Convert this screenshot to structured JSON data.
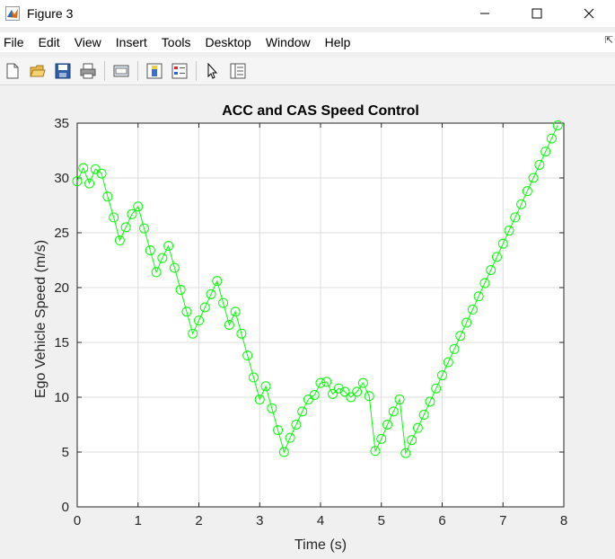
{
  "window": {
    "title": "Figure 3"
  },
  "menu": [
    "File",
    "Edit",
    "View",
    "Insert",
    "Tools",
    "Desktop",
    "Window",
    "Help"
  ],
  "toolbar": [
    "new-figure-icon",
    "open-folder-icon",
    "save-icon",
    "print-icon",
    "link-plot-icon",
    "colorbar-icon",
    "legend-icon",
    "pointer-icon",
    "property-inspector-icon"
  ],
  "colors": {
    "line": "#00ff00",
    "grid": "#dcdcdc",
    "axes_bg": "#ffffff"
  },
  "chart_data": {
    "type": "line",
    "title": "ACC and CAS Speed Control",
    "xlabel": "Time (s)",
    "ylabel": "Ego Vehicle Speed (m/s)",
    "xlim": [
      0,
      8
    ],
    "ylim": [
      0,
      35
    ],
    "xticks": [
      0,
      1,
      2,
      3,
      4,
      5,
      6,
      7,
      8
    ],
    "yticks": [
      0,
      5,
      10,
      15,
      20,
      25,
      30,
      35
    ],
    "grid": true,
    "marker": "circle",
    "x": [
      0,
      0.1,
      0.2,
      0.3,
      0.4,
      0.5,
      0.6,
      0.7,
      0.8,
      0.9,
      1.0,
      1.1,
      1.2,
      1.3,
      1.4,
      1.5,
      1.6,
      1.7,
      1.8,
      1.9,
      2.0,
      2.1,
      2.2,
      2.3,
      2.4,
      2.5,
      2.6,
      2.7,
      2.8,
      2.9,
      3.0,
      3.1,
      3.2,
      3.3,
      3.4,
      3.5,
      3.6,
      3.7,
      3.8,
      3.9,
      4.0,
      4.1,
      4.2,
      4.3,
      4.4,
      4.5,
      4.6,
      4.7,
      4.8,
      4.9,
      5.0,
      5.1,
      5.2,
      5.3,
      5.4,
      5.5,
      5.6,
      5.7,
      5.8,
      5.9,
      6.0,
      6.1,
      6.2,
      6.3,
      6.4,
      6.5,
      6.6,
      6.7,
      6.8,
      6.9,
      7.0,
      7.1,
      7.2,
      7.3,
      7.4,
      7.5,
      7.6,
      7.7,
      7.8,
      7.9
    ],
    "y": [
      29.7,
      30.9,
      29.5,
      30.8,
      30.4,
      28.3,
      26.4,
      24.3,
      25.5,
      26.7,
      27.4,
      25.4,
      23.4,
      21.4,
      22.7,
      23.8,
      21.8,
      19.8,
      17.8,
      15.8,
      17.0,
      18.2,
      19.4,
      20.6,
      18.6,
      16.6,
      17.8,
      15.8,
      13.8,
      11.8,
      9.8,
      11.0,
      9.0,
      7.0,
      5.0,
      6.3,
      7.5,
      8.7,
      9.8,
      10.2,
      11.3,
      11.4,
      10.3,
      10.8,
      10.5,
      10.0,
      10.5,
      11.3,
      10.1,
      5.1,
      6.2,
      7.5,
      8.7,
      9.8,
      4.9,
      6.1,
      7.2,
      8.4,
      9.6,
      10.8,
      12.0,
      13.2,
      14.4,
      15.6,
      16.8,
      18.0,
      19.2,
      20.4,
      21.6,
      22.8,
      24.0,
      25.2,
      26.4,
      27.6,
      28.8,
      30.0,
      31.2,
      32.4,
      33.6,
      34.8
    ]
  }
}
